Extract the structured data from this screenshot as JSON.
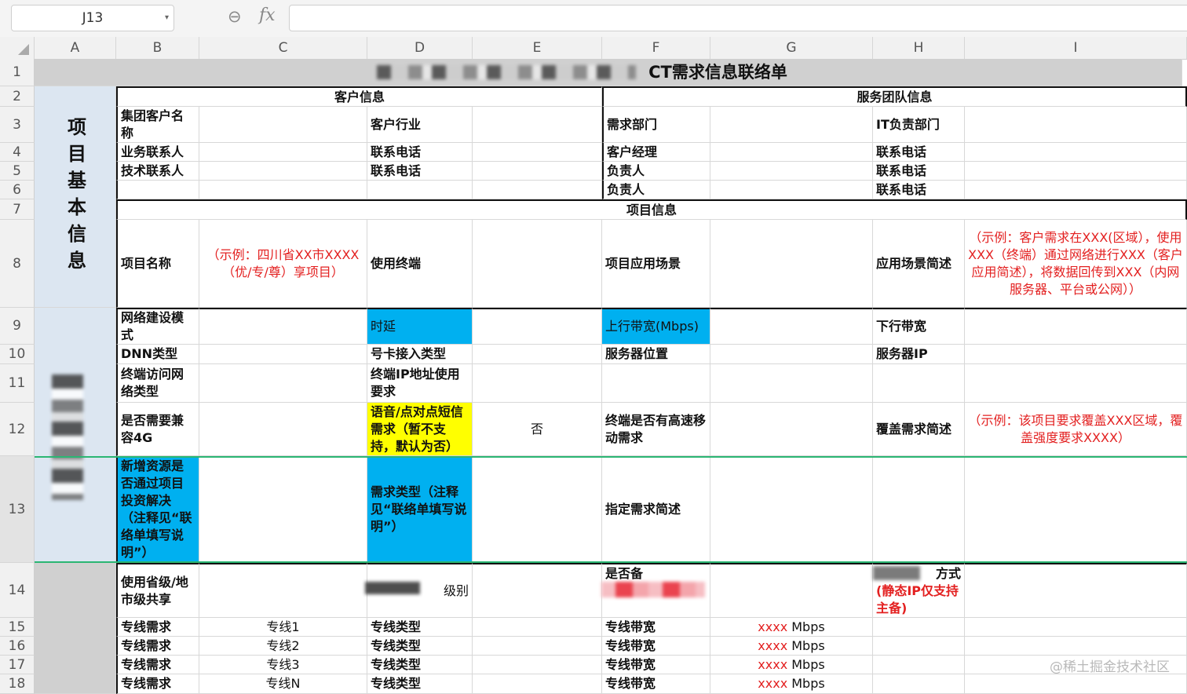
{
  "formula_bar": {
    "cell_ref": "J13",
    "fx": "fx"
  },
  "columns": [
    "A",
    "B",
    "C",
    "D",
    "E",
    "F",
    "G",
    "H",
    "I"
  ],
  "rows": [
    "1",
    "2",
    "3",
    "4",
    "5",
    "6",
    "7",
    "8",
    "9",
    "10",
    "11",
    "12",
    "13",
    "14",
    "15",
    "16",
    "17",
    "18"
  ],
  "title": "CT需求信息联络单",
  "sections": {
    "customer": "客户信息",
    "service": "服务团队信息",
    "project": "项目信息",
    "basic": "项目基本信息"
  },
  "r3": {
    "b": "集团客户名称",
    "d": "客户行业",
    "f": "需求部门",
    "h": "IT负责部门"
  },
  "r4": {
    "b": "业务联系人",
    "d": "联系电话",
    "f": "客户经理",
    "h": "联系电话"
  },
  "r5": {
    "b": "技术联系人",
    "d": "联系电话",
    "f": "负责人",
    "h": "联系电话"
  },
  "r6": {
    "f": "负责人",
    "h": "联系电话"
  },
  "r8": {
    "b": "项目名称",
    "c": "（示例：四川省XX市XXXX（优/专/尊）享项目）",
    "d": "使用终端",
    "f": "项目应用场景",
    "h": "应用场景简述",
    "i": "（示例：客户需求在XXX(区域），使用XXX（终端）通过网络进行XXX（客户应用简述），将数据回传到XXX（内网服务器、平台或公网））"
  },
  "r9": {
    "b": "网络建设模式",
    "d": "时延",
    "f": "上行带宽(Mbps)",
    "h": "下行带宽"
  },
  "r10": {
    "b": "DNN类型",
    "d": "号卡接入类型",
    "f": "服务器位置",
    "h": "服务器IP"
  },
  "r11": {
    "b": "终端访问网络类型",
    "d": "终端IP地址使用要求"
  },
  "r12": {
    "b": "是否需要兼容4G",
    "d": "语音/点对点短信需求（暂不支持，默认为否）",
    "e": "否",
    "f": "终端是否有高速移动需求",
    "h": "覆盖需求简述",
    "i": "（示例：该项目要求覆盖XXX区域，覆盖强度要求XXXX）"
  },
  "r13": {
    "b": "新增资源是否通过项目投资解决（注释见“联络单填写说明”）",
    "d": "需求类型（注释见“联络单填写说明”）",
    "f": "指定需求简述"
  },
  "r14": {
    "b": "使用省级/地市级共享",
    "d": "级别",
    "f": "是否备",
    "h": "方式",
    "h2": "(静态IP仅支持主备)"
  },
  "lines": [
    {
      "b": "专线需求",
      "c": "专线1",
      "d": "专线类型",
      "f": "专线带宽",
      "g_red": "xxxx",
      "g_unit": "Mbps"
    },
    {
      "b": "专线需求",
      "c": "专线2",
      "d": "专线类型",
      "f": "专线带宽",
      "g_red": "xxxx",
      "g_unit": "Mbps"
    },
    {
      "b": "专线需求",
      "c": "专线3",
      "d": "专线类型",
      "f": "专线带宽",
      "g_red": "xxxx",
      "g_unit": "Mbps"
    },
    {
      "b": "专线需求",
      "c": "专线N",
      "d": "专线类型",
      "f": "专线带宽",
      "g_red": "xxxx",
      "g_unit": "Mbps"
    }
  ],
  "watermark": "@稀土掘金技术社区"
}
